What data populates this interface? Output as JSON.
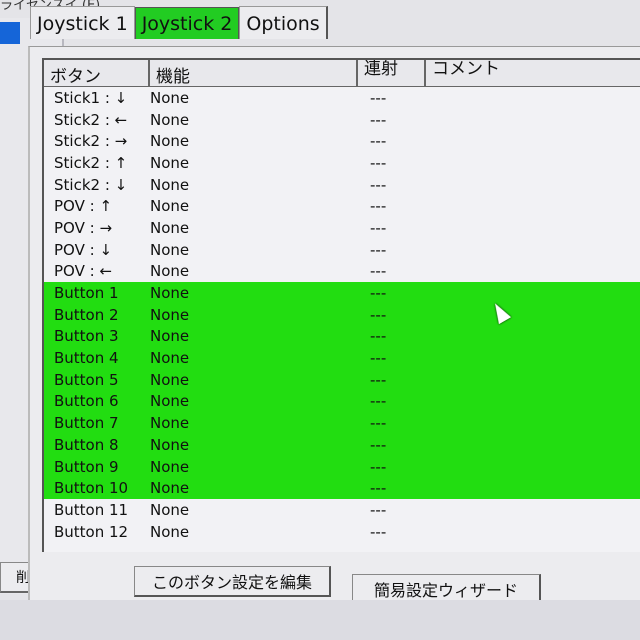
{
  "menu": {
    "partial_label": "ライセンスイ (E)"
  },
  "tabs": [
    {
      "label": "Joystick 1",
      "active": false
    },
    {
      "label": "Joystick 2",
      "active": true
    },
    {
      "label": "Options",
      "active": false
    }
  ],
  "columns": [
    "ボタン",
    "機能",
    "連射",
    "コメント"
  ],
  "rows": [
    {
      "button": "Stick1 : ↓",
      "function": "None",
      "rapid": "---",
      "selected": false
    },
    {
      "button": "Stick2 : ←",
      "function": "None",
      "rapid": "---",
      "selected": false
    },
    {
      "button": "Stick2 : →",
      "function": "None",
      "rapid": "---",
      "selected": false
    },
    {
      "button": "Stick2 : ↑",
      "function": "None",
      "rapid": "---",
      "selected": false
    },
    {
      "button": "Stick2 : ↓",
      "function": "None",
      "rapid": "---",
      "selected": false
    },
    {
      "button": "POV : ↑",
      "function": "None",
      "rapid": "---",
      "selected": false
    },
    {
      "button": "POV : →",
      "function": "None",
      "rapid": "---",
      "selected": false
    },
    {
      "button": "POV : ↓",
      "function": "None",
      "rapid": "---",
      "selected": false
    },
    {
      "button": "POV : ←",
      "function": "None",
      "rapid": "---",
      "selected": false
    },
    {
      "button": "Button 1",
      "function": "None",
      "rapid": "---",
      "selected": true
    },
    {
      "button": "Button 2",
      "function": "None",
      "rapid": "---",
      "selected": true
    },
    {
      "button": "Button 3",
      "function": "None",
      "rapid": "---",
      "selected": true
    },
    {
      "button": "Button 4",
      "function": "None",
      "rapid": "---",
      "selected": true
    },
    {
      "button": "Button 5",
      "function": "None",
      "rapid": "---",
      "selected": true
    },
    {
      "button": "Button 6",
      "function": "None",
      "rapid": "---",
      "selected": true
    },
    {
      "button": "Button 7",
      "function": "None",
      "rapid": "---",
      "selected": true
    },
    {
      "button": "Button 8",
      "function": "None",
      "rapid": "---",
      "selected": true
    },
    {
      "button": "Button 9",
      "function": "None",
      "rapid": "---",
      "selected": true
    },
    {
      "button": "Button 10",
      "function": "None",
      "rapid": "---",
      "selected": true
    },
    {
      "button": "Button 11",
      "function": "None",
      "rapid": "---",
      "selected": false
    },
    {
      "button": "Button 12",
      "function": "None",
      "rapid": "---",
      "selected": false
    }
  ],
  "buttons": {
    "delete": "削除",
    "edit": "このボタン設定を編集",
    "wizard": "簡易設定ウィザード"
  },
  "colors": {
    "selection": "#22dd11",
    "active_tab": "#22cc22"
  }
}
